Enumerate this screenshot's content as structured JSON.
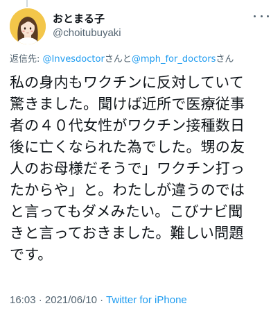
{
  "user": {
    "display_name": "おとまる子",
    "handle": "@choitubuyaki"
  },
  "reply_context": {
    "prefix": "返信先: ",
    "mention_1": "@Invesdoctor",
    "joiner": "さんと",
    "mention_2": "@mph_for_doctors",
    "suffix": "さん"
  },
  "tweet": {
    "lines": [
      "私の身内もワクチンに反対していて",
      "驚きました。聞けば近所で医療従事",
      "者の４０代女性がワクチン接種数日",
      "後に亡くなられた為でした。甥の友",
      "人のお母様だそうで」ワクチン打っ",
      "たからや」と。わたしが違うのでは",
      "と言ってもダメみたい。こびナビ聞",
      "きと言っておきました。難しい問題",
      "です。"
    ]
  },
  "meta": {
    "time": "16:03",
    "separator_1": " · ",
    "date": "2021/06/10",
    "separator_2": " · ",
    "source": "Twitter for iPhone"
  },
  "icons": {
    "avatar": "avatar-girl-illustration",
    "more": "more-options-icon"
  },
  "colors": {
    "link": "#1d9bf0",
    "secondary_text": "#536471",
    "primary_text": "#0f1419",
    "avatar_bg": "#f3c64a"
  }
}
